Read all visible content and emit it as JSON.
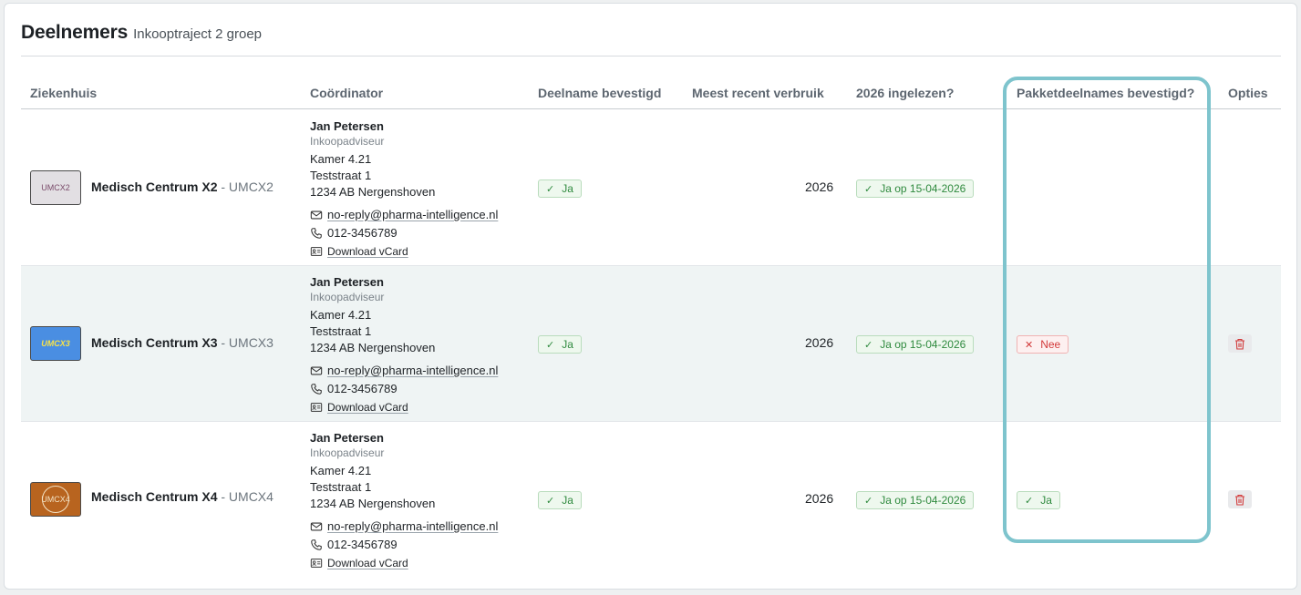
{
  "header": {
    "title": "Deelnemers",
    "subtitle": "Inkooptraject 2 groep"
  },
  "columns": {
    "hospital": "Ziekenhuis",
    "coordinator": "Coördinator",
    "confirmed": "Deelname bevestigd",
    "usage": "Meest recent verbruik",
    "imported": "2026 ingelezen?",
    "package": "Pakketdeelnames bevestigd?",
    "options": "Opties"
  },
  "rows": [
    {
      "logo_text": "UMCX2",
      "name": "Medisch Centrum X2",
      "code": "- UMCX2",
      "coordinator": {
        "name": "Jan Petersen",
        "role": "Inkoopadviseur",
        "room": "Kamer 4.21",
        "street": "Teststraat 1",
        "city": "1234 AB Nergenshoven",
        "email": "no-reply@pharma-intelligence.nl",
        "phone": "012-3456789",
        "vcard": "Download vCard"
      },
      "confirmed": "Ja",
      "usage": "2026",
      "imported": "Ja op 15-04-2026",
      "package": null
    },
    {
      "logo_text": "UMCX3",
      "name": "Medisch Centrum X3",
      "code": "- UMCX3",
      "coordinator": {
        "name": "Jan Petersen",
        "role": "Inkoopadviseur",
        "room": "Kamer 4.21",
        "street": "Teststraat 1",
        "city": "1234 AB Nergenshoven",
        "email": "no-reply@pharma-intelligence.nl",
        "phone": "012-3456789",
        "vcard": "Download vCard"
      },
      "confirmed": "Ja",
      "usage": "2026",
      "imported": "Ja op 15-04-2026",
      "package": "Nee"
    },
    {
      "logo_text": "UMCX4",
      "name": "Medisch Centrum X4",
      "code": "- UMCX4",
      "coordinator": {
        "name": "Jan Petersen",
        "role": "Inkoopadviseur",
        "room": "Kamer 4.21",
        "street": "Teststraat 1",
        "city": "1234 AB Nergenshoven",
        "email": "no-reply@pharma-intelligence.nl",
        "phone": "012-3456789",
        "vcard": "Download vCard"
      },
      "confirmed": "Ja",
      "usage": "2026",
      "imported": "Ja op 15-04-2026",
      "package": "Ja"
    }
  ],
  "icons": {
    "check": "check-icon",
    "cross": "x-icon",
    "mail": "envelope-icon",
    "phone": "phone-icon",
    "vcard": "id-card-icon",
    "delete": "trash-icon"
  },
  "colors": {
    "success": "#2f8a3e",
    "danger": "#d23a3a",
    "highlight": "#7ec4cd"
  }
}
